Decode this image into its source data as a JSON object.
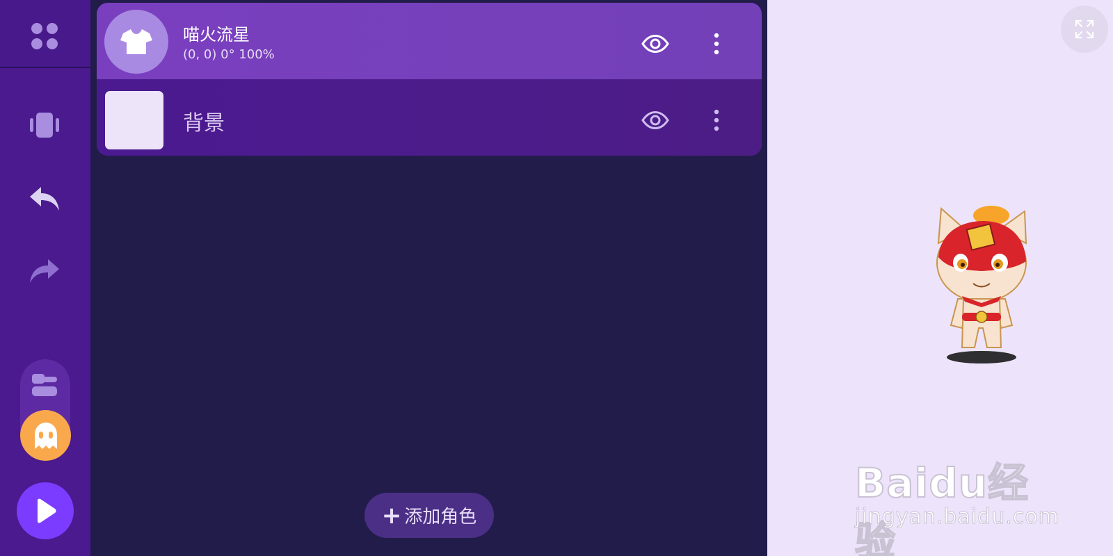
{
  "toolbar": {
    "items": [
      {
        "name": "apps-menu",
        "icon": "grid-dots-icon"
      },
      {
        "name": "device",
        "icon": "phone-vibrate-icon"
      },
      {
        "name": "undo",
        "icon": "undo-arrow-icon"
      },
      {
        "name": "redo",
        "icon": "redo-arrow-icon"
      },
      {
        "name": "blocks",
        "icon": "blocks-icon"
      },
      {
        "name": "role",
        "icon": "ghost-icon"
      },
      {
        "name": "play",
        "icon": "play-icon"
      }
    ]
  },
  "sprites": [
    {
      "name": "喵火流星",
      "info": "(0, 0) 0° 100%",
      "thumb_icon": "tshirt-icon",
      "selected": true
    },
    {
      "name": "背景",
      "info": "",
      "thumb_icon": "",
      "selected": false
    }
  ],
  "add_role": {
    "plus": "+",
    "label": "添加角色"
  },
  "stage": {
    "fullscreen_icon": "fullscreen-icon",
    "watermark": {
      "logo_text": "Bai",
      "logo_paw": "du",
      "logo_suffix": "经验",
      "url": "jingyan.baidu.com"
    }
  },
  "colors": {
    "toolbar_bg": "#4a1a8e",
    "panel_bg": "#221c4b",
    "selected_row": "#7a3fbf",
    "stage_bg": "#ede4fb",
    "play_accent": "#7c3cff",
    "role_accent": "#f9a84c"
  }
}
